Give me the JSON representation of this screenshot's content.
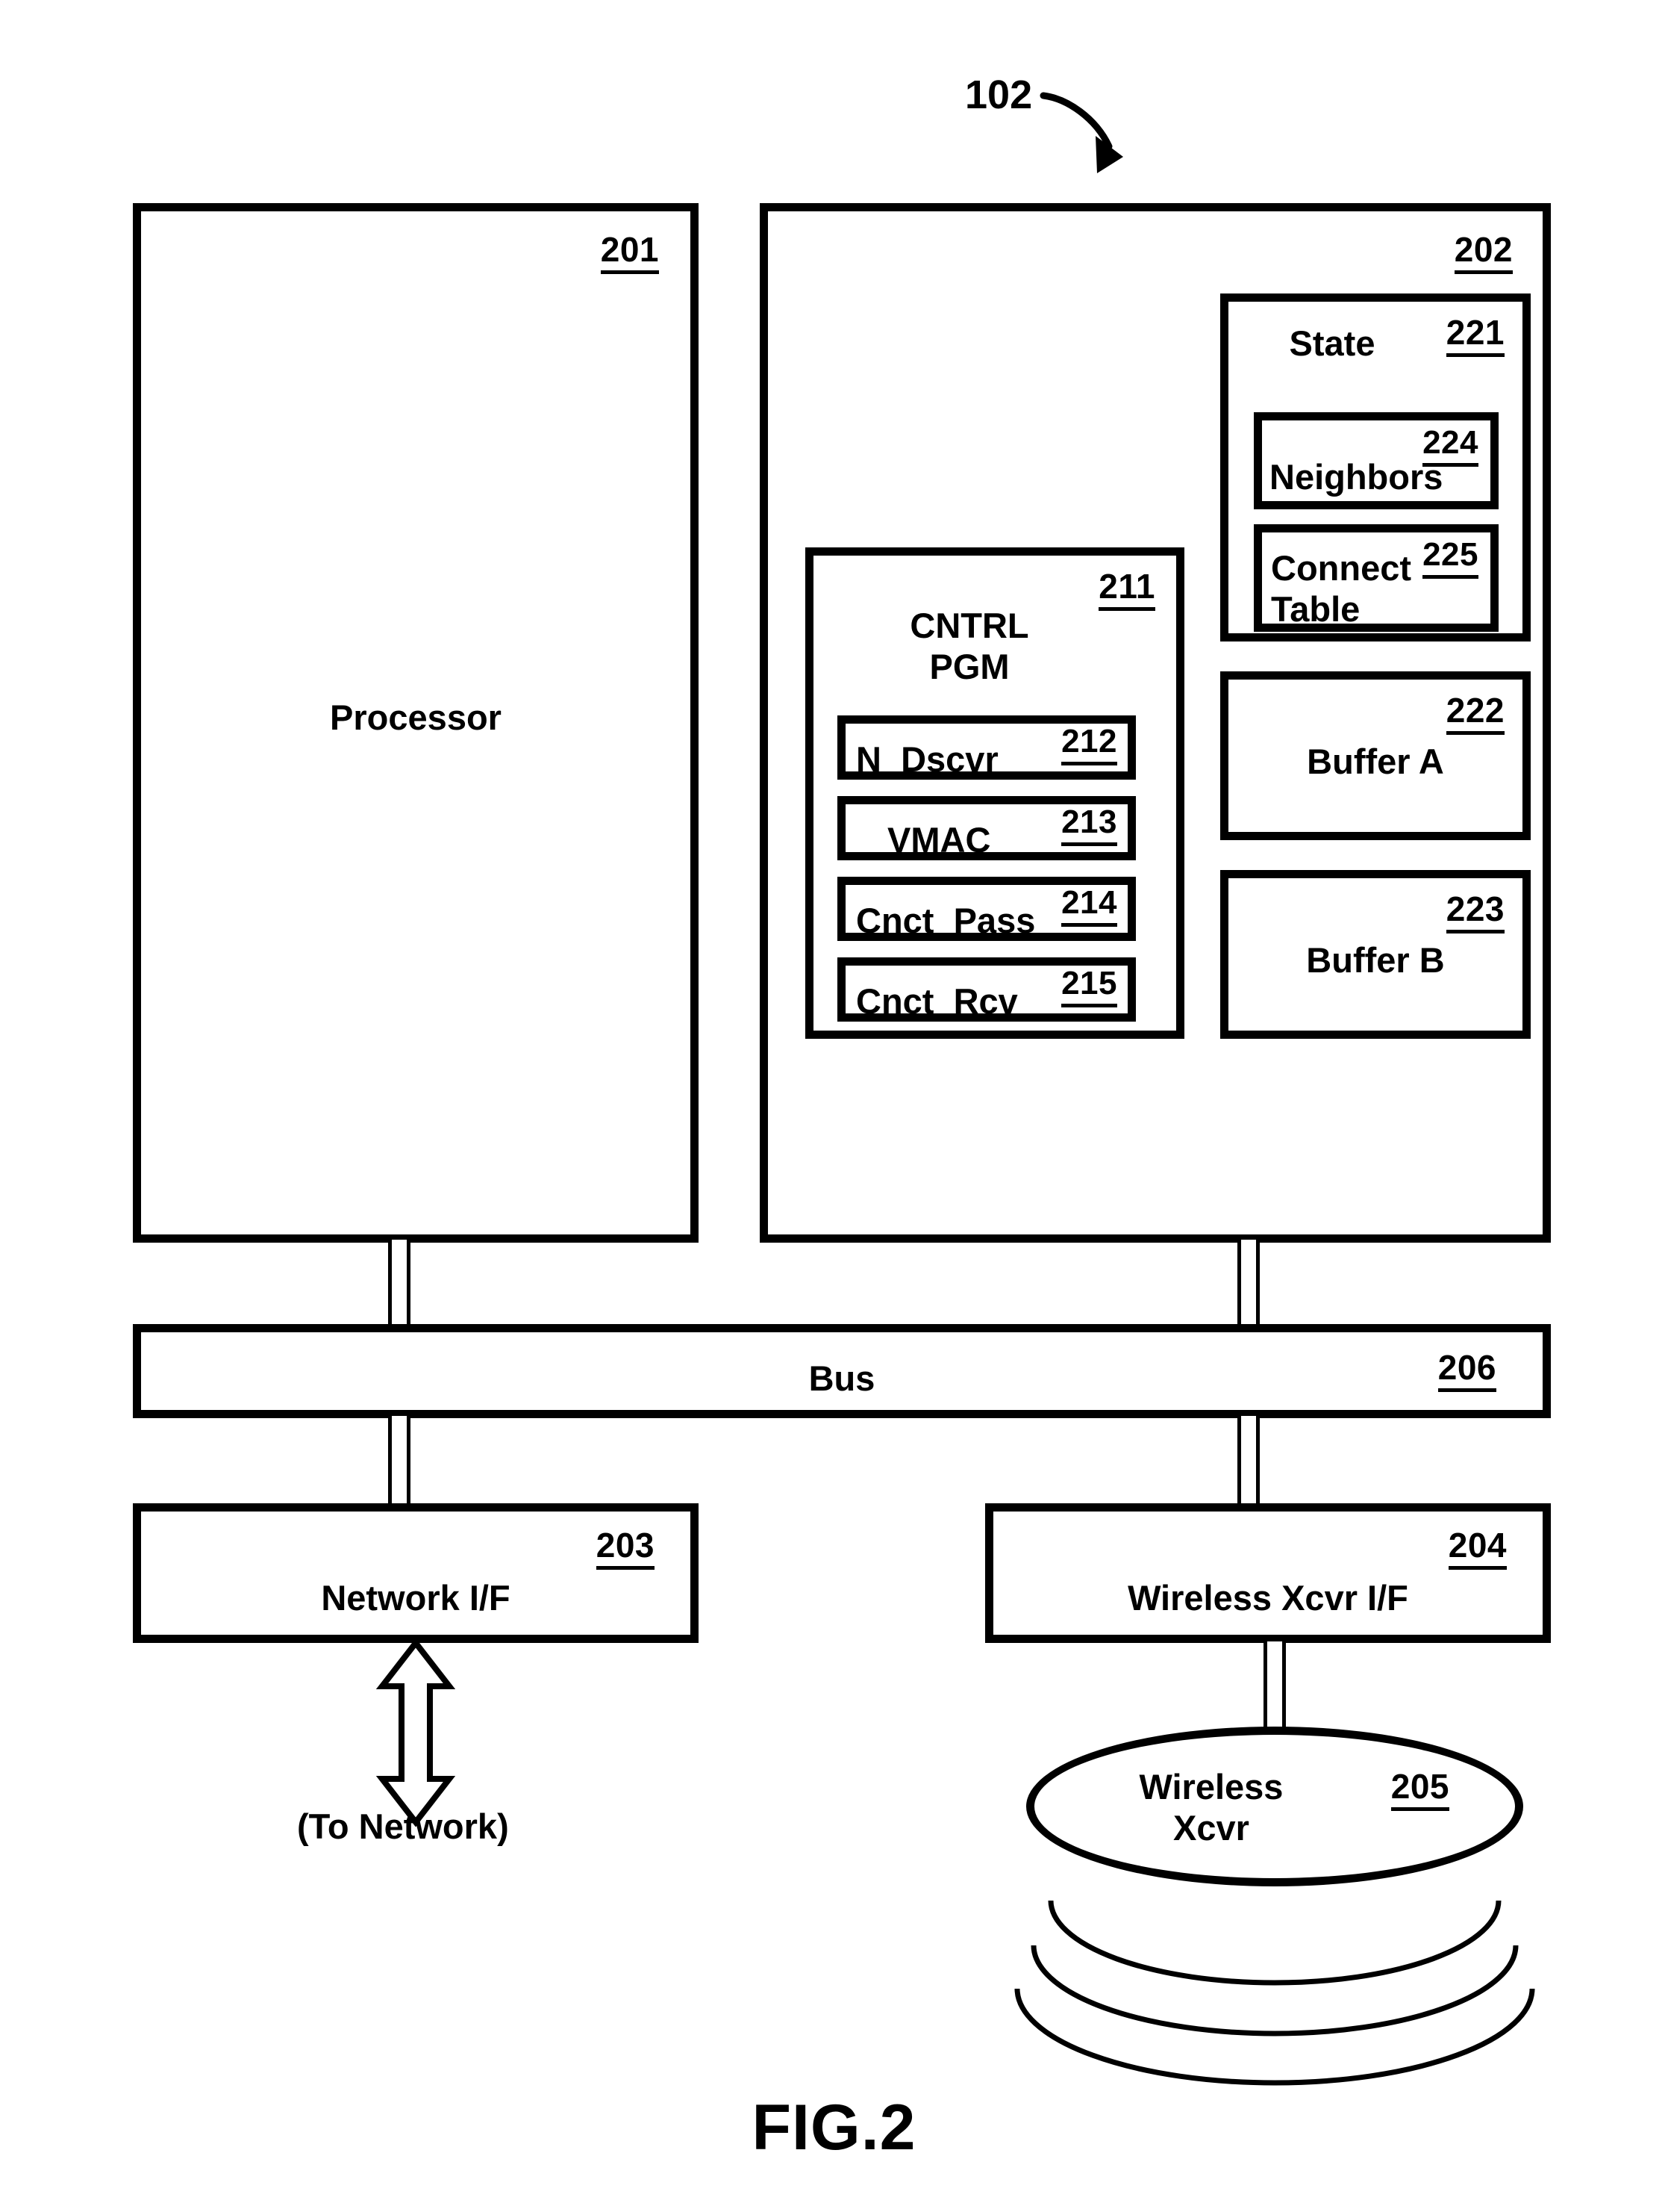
{
  "figure": {
    "title": "FIG.2",
    "top_reference": "102"
  },
  "blocks": {
    "processor": {
      "label": "Processor",
      "ref": "201"
    },
    "memory": {
      "ref": "202"
    },
    "state": {
      "label": "State",
      "ref": "221"
    },
    "neighbors": {
      "label": "Neighbors",
      "ref": "224"
    },
    "connect_table": {
      "label": "Connect\nTable",
      "ref": "225"
    },
    "buffer_a": {
      "label": "Buffer A",
      "ref": "222"
    },
    "buffer_b": {
      "label": "Buffer B",
      "ref": "223"
    },
    "cntrl_pgm": {
      "label": "CNTRL\nPGM",
      "ref": "211"
    },
    "n_dscvr": {
      "label": "N_Dscvr",
      "ref": "212"
    },
    "vmac": {
      "label": "VMAC",
      "ref": "213"
    },
    "cnct_pass": {
      "label": "Cnct_Pass",
      "ref": "214"
    },
    "cnct_rcv": {
      "label": "Cnct_Rcv",
      "ref": "215"
    },
    "bus": {
      "label": "Bus",
      "ref": "206"
    },
    "network_if": {
      "label": "Network I/F",
      "ref": "203"
    },
    "wireless_xcvr_if": {
      "label": "Wireless Xcvr I/F",
      "ref": "204"
    },
    "wireless_xcvr": {
      "label": "Wireless\nXcvr",
      "ref": "205"
    }
  },
  "annotations": {
    "to_network": "(To Network)"
  }
}
